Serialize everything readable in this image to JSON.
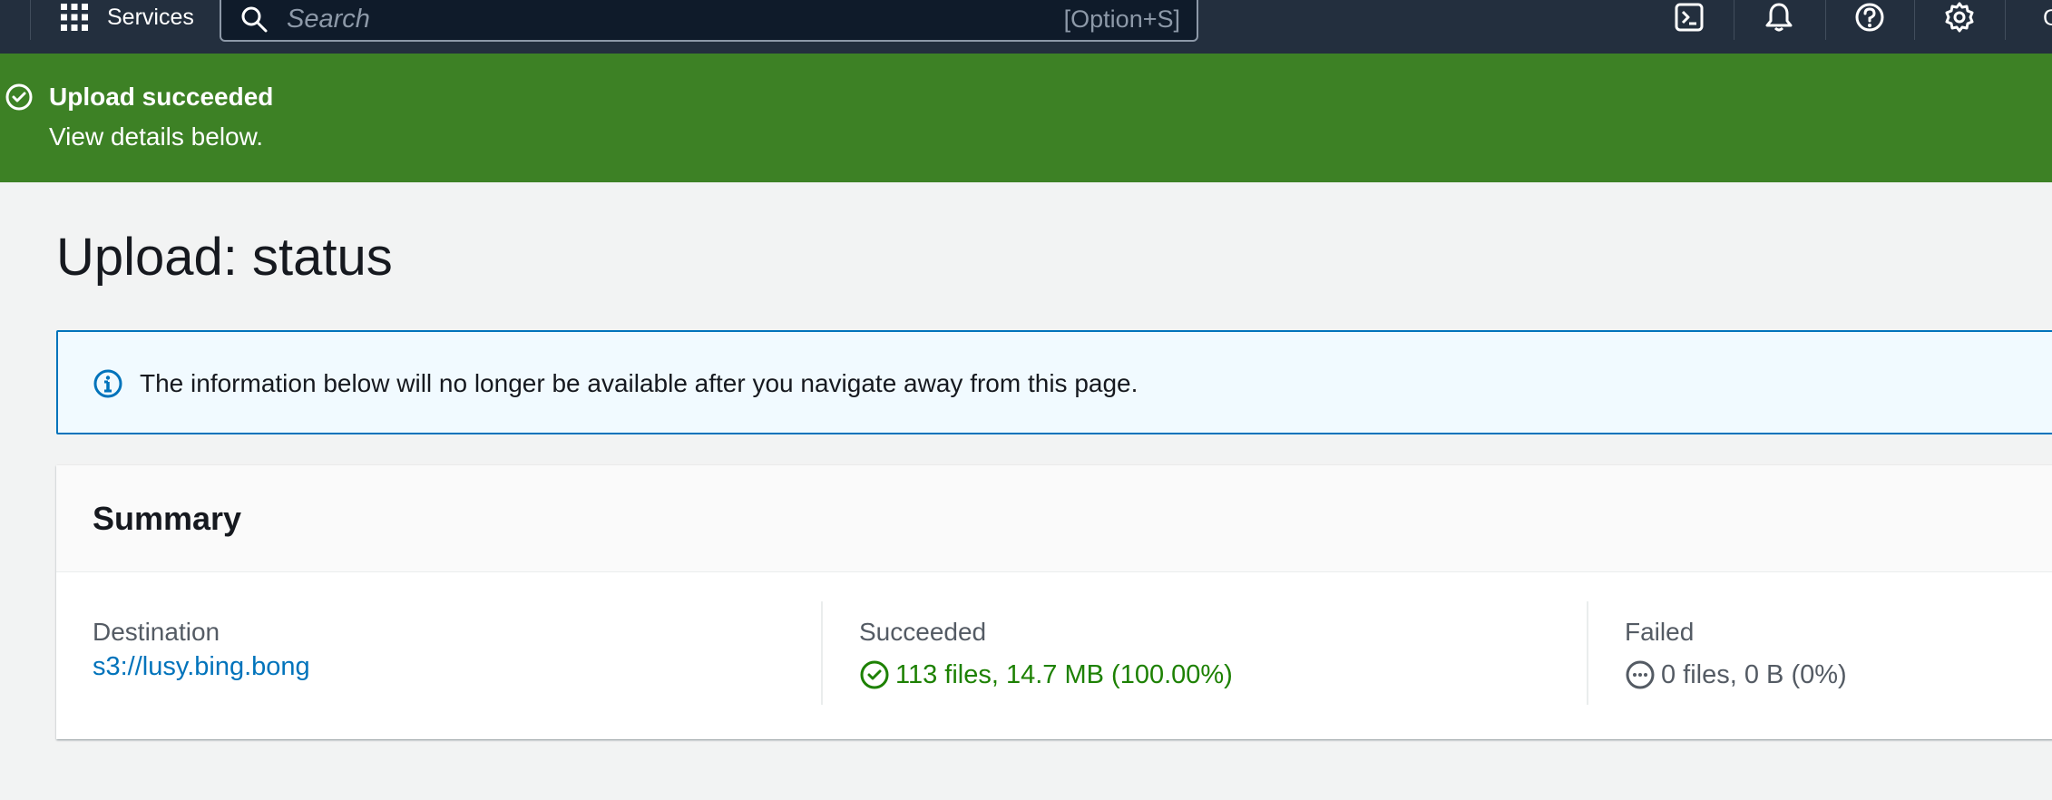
{
  "topbar": {
    "services_label": "Services",
    "search_placeholder": "Search",
    "search_shortcut": "[Option+S]",
    "icons": [
      "cloudshell-icon",
      "bell-icon",
      "help-icon",
      "gear-icon"
    ],
    "account_initial": "G"
  },
  "flash": {
    "title": "Upload succeeded",
    "detail": "View details below.",
    "color": "#3d8125"
  },
  "page": {
    "title": "Upload: status"
  },
  "info_alert": {
    "message": "The information below will no longer be available after you navigate away from this page."
  },
  "summary": {
    "heading": "Summary",
    "destination": {
      "label": "Destination",
      "value": "s3://lusy.bing.bong"
    },
    "succeeded": {
      "label": "Succeeded",
      "value": "113 files, 14.7 MB (100.00%)",
      "color": "#1d8102"
    },
    "failed": {
      "label": "Failed",
      "value": "0 files, 0 B (0%)"
    }
  }
}
